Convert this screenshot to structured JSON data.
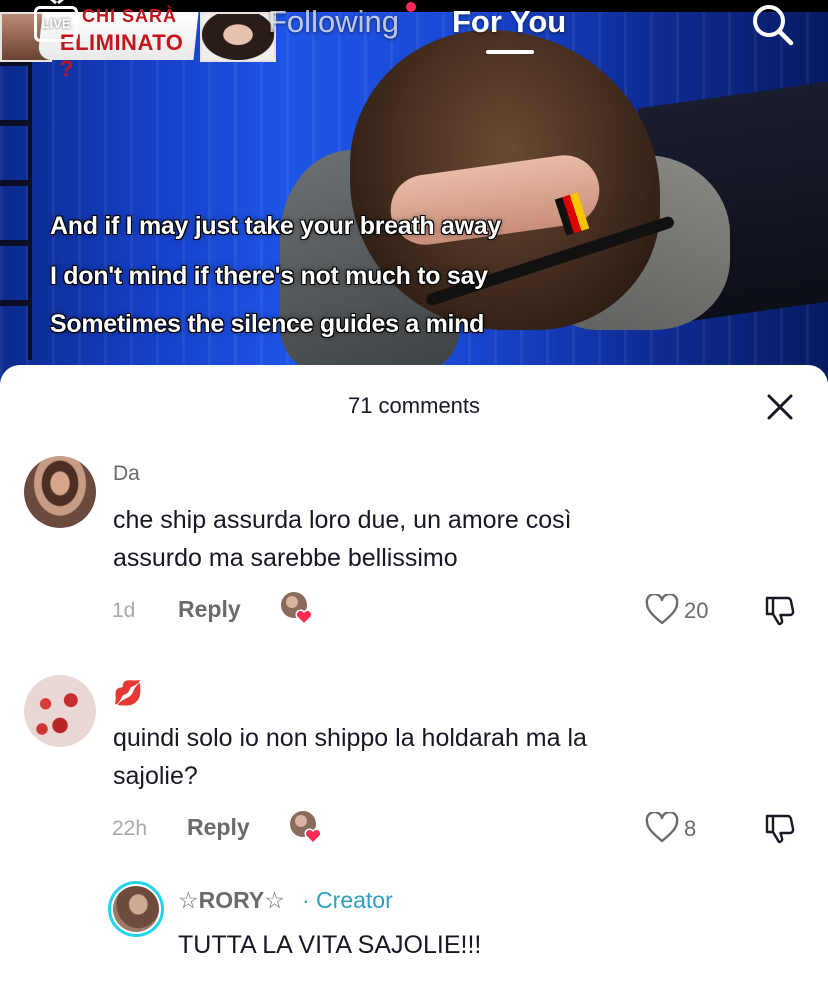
{
  "header": {
    "live_label": "LIVE",
    "tabs": [
      {
        "label": "Following"
      },
      {
        "label": "For You"
      }
    ],
    "banner": {
      "line1": "CHI SARÀ",
      "line2": "ELIMINATO ?"
    }
  },
  "video": {
    "captions": [
      "And if I may just take your breath away",
      "I don't mind if there's not much to say",
      "Sometimes the silence guides a mind"
    ]
  },
  "comments_panel": {
    "title": "71 comments",
    "comments": [
      {
        "username": "Da",
        "text_lines": [
          "che ship assurda loro due, un amore così",
          "assurdo ma sarebbe bellissimo"
        ],
        "time": "1d",
        "reply_label": "Reply",
        "likes": "20"
      },
      {
        "username": "💋",
        "text_lines": [
          "quindi solo io non shippo la holdarah ma la",
          "sajolie?"
        ],
        "time": "22h",
        "reply_label": "Reply",
        "likes": "8"
      }
    ],
    "creator_reply": {
      "username": "☆RORY☆",
      "badge": "· Creator",
      "text": "TUTTA LA VITA SAJOLIE!!!"
    }
  },
  "colors": {
    "accent_red": "#fe2c55",
    "creator_blue": "#2d9fc0",
    "avatar_ring": "#20d5ec"
  },
  "icons": [
    "live-icon",
    "search-icon",
    "close-icon",
    "heart-outline-icon",
    "dislike-icon",
    "liked-by-creator-icon",
    "lips-emoji-icon"
  ]
}
